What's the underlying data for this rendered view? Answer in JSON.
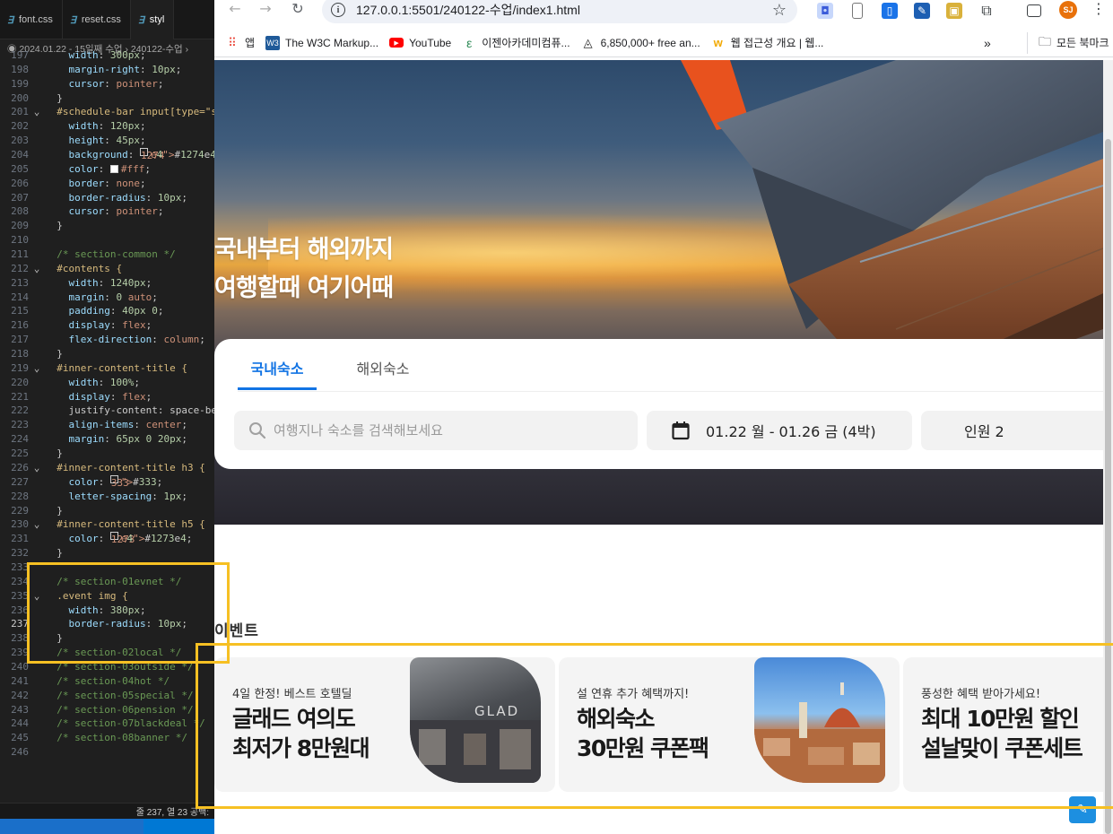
{
  "editor": {
    "tabs": [
      {
        "label": "font.css"
      },
      {
        "label": "reset.css"
      },
      {
        "label": "styl"
      }
    ],
    "breadcrumb": "◉ 2024.01.22 - 15일째 수업 › 240122-수업 › ",
    "status": "줄 237, 열 23   공백: ",
    "lines": [
      {
        "n": "197",
        "t": "    width: 300px;"
      },
      {
        "n": "198",
        "t": "    margin-right: 10px;"
      },
      {
        "n": "199",
        "t": "    cursor: pointer;"
      },
      {
        "n": "200",
        "t": "  }"
      },
      {
        "n": "201",
        "t": "  #schedule-bar input[type=\"sub"
      },
      {
        "n": "202",
        "t": "    width: 120px;"
      },
      {
        "n": "203",
        "t": "    height: 45px;"
      },
      {
        "n": "204",
        "t": "    background: #1274e4;"
      },
      {
        "n": "205",
        "t": "    color: #fff;"
      },
      {
        "n": "206",
        "t": "    border: none;"
      },
      {
        "n": "207",
        "t": "    border-radius: 10px;"
      },
      {
        "n": "208",
        "t": "    cursor: pointer;"
      },
      {
        "n": "209",
        "t": "  }"
      },
      {
        "n": "210",
        "t": ""
      },
      {
        "n": "211",
        "t": "  /* section-common */"
      },
      {
        "n": "212",
        "t": "  #contents {"
      },
      {
        "n": "213",
        "t": "    width: 1240px;"
      },
      {
        "n": "214",
        "t": "    margin: 0 auto;"
      },
      {
        "n": "215",
        "t": "    padding: 40px 0;"
      },
      {
        "n": "216",
        "t": "    display: flex;"
      },
      {
        "n": "217",
        "t": "    flex-direction: column;"
      },
      {
        "n": "218",
        "t": "  }"
      },
      {
        "n": "219",
        "t": "  #inner-content-title {"
      },
      {
        "n": "220",
        "t": "    width: 100%;"
      },
      {
        "n": "221",
        "t": "    display: flex;"
      },
      {
        "n": "222",
        "t": "    justify-content: space-betw"
      },
      {
        "n": "223",
        "t": "    align-items: center;"
      },
      {
        "n": "224",
        "t": "    margin: 65px 0 20px;"
      },
      {
        "n": "225",
        "t": "  }"
      },
      {
        "n": "226",
        "t": "  #inner-content-title h3 {"
      },
      {
        "n": "227",
        "t": "    color: #333;"
      },
      {
        "n": "228",
        "t": "    letter-spacing: 1px;"
      },
      {
        "n": "229",
        "t": "  }"
      },
      {
        "n": "230",
        "t": "  #inner-content-title h5 {"
      },
      {
        "n": "231",
        "t": "    color: #1273e4;"
      },
      {
        "n": "232",
        "t": "  }"
      },
      {
        "n": "233",
        "t": ""
      },
      {
        "n": "234",
        "t": "  /* section-01evnet */"
      },
      {
        "n": "235",
        "t": "  .event img {"
      },
      {
        "n": "236",
        "t": "    width: 380px;"
      },
      {
        "n": "237",
        "t": "    border-radius: 10px;"
      },
      {
        "n": "238",
        "t": "  }"
      },
      {
        "n": "239",
        "t": "  /* section-02local */"
      },
      {
        "n": "240",
        "t": "  /* section-03outside */"
      },
      {
        "n": "241",
        "t": "  /* section-04hot */"
      },
      {
        "n": "242",
        "t": "  /* section-05special */"
      },
      {
        "n": "243",
        "t": "  /* section-06pension */"
      },
      {
        "n": "244",
        "t": "  /* section-07blackdeal */"
      },
      {
        "n": "245",
        "t": "  /* section-08banner */"
      },
      {
        "n": "246",
        "t": ""
      }
    ]
  },
  "browser": {
    "url": "127.0.0.1:5501/240122-수업/index1.html",
    "profile_initials": "SJ",
    "bookmarks": [
      {
        "label": "앱",
        "icon": "apps-grid-icon"
      },
      {
        "label": "The W3C Markup...",
        "icon": "w3c-icon"
      },
      {
        "label": "YouTube",
        "icon": "youtube-icon"
      },
      {
        "label": "이젠아카데미컴퓨...",
        "icon": "academy-icon"
      },
      {
        "label": "6,850,000+ free an...",
        "icon": "free-icons-icon"
      },
      {
        "label": "웹 접근성 개요 | 웹...",
        "icon": "web-accessibility-icon"
      }
    ],
    "all_bookmarks": "모든 북마크"
  },
  "page": {
    "hero": {
      "line1": "국내부터 해외까지",
      "line2": "여행할때 여기어때"
    },
    "search": {
      "tab_domestic": "국내숙소",
      "tab_overseas": "해외숙소",
      "placeholder": "여행지나 숙소를 검색해보세요",
      "dates": "01.22 월 - 01.26 금 (4박)",
      "people": "인원 2"
    },
    "event_title": "이벤트",
    "events": [
      {
        "sub": "4일 한정! 베스트 호텔딜",
        "line1": "글래드 여의도",
        "line2": "최저가 8만원대",
        "pic_text": "GLAD"
      },
      {
        "sub": "설 연휴 추가 혜택까지!",
        "line1": "해외숙소",
        "line2": "30만원 쿠폰팩"
      },
      {
        "sub": "풍성한 혜택 받아가세요!",
        "line1": "최대 10만원 할인",
        "line2": "설날맞이 쿠폰세트"
      }
    ]
  },
  "colors": {
    "accent": "#1274e4",
    "highlight": "#f6c023",
    "editor_bg": "#1f1f1f"
  }
}
